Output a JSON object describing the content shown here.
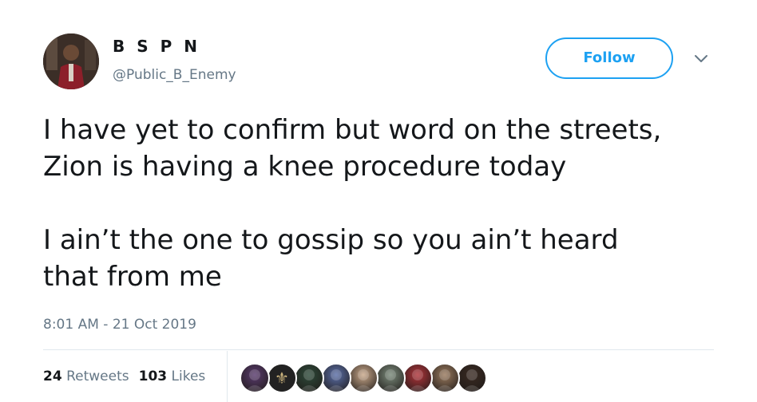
{
  "author": {
    "display_name": "B S P N",
    "handle": "@Public_B_Enemy",
    "avatar_icon": "profile-photo-avatar"
  },
  "follow_button": {
    "label": "Follow",
    "color": "#1da1f2"
  },
  "menu": {
    "icon": "chevron-down-icon"
  },
  "tweet": {
    "text": "I have yet to confirm but word on the streets,\nZion is having a knee procedure today\n\nI ain’t the one to gossip so you ain’t heard\nthat from me",
    "timestamp": "8:01 AM - 21 Oct 2019"
  },
  "stats": {
    "retweets_count": "24",
    "retweets_label": "Retweets",
    "likes_count": "103",
    "likes_label": "Likes"
  },
  "likers": [
    {
      "icon": "liker-avatar",
      "color": "#5a3b6e"
    },
    {
      "icon": "saints-fleur-de-lis-avatar",
      "color": "#3a3a3a"
    },
    {
      "icon": "liker-avatar",
      "color": "#2e4a3a"
    },
    {
      "icon": "liker-avatar",
      "color": "#5b6fa8"
    },
    {
      "icon": "liker-avatar",
      "color": "#c9a88a"
    },
    {
      "icon": "liker-avatar",
      "color": "#7a8a7a"
    },
    {
      "icon": "liker-avatar",
      "color": "#b0343a"
    },
    {
      "icon": "liker-avatar",
      "color": "#9a7a5e"
    },
    {
      "icon": "liker-avatar",
      "color": "#3a2a22"
    }
  ]
}
